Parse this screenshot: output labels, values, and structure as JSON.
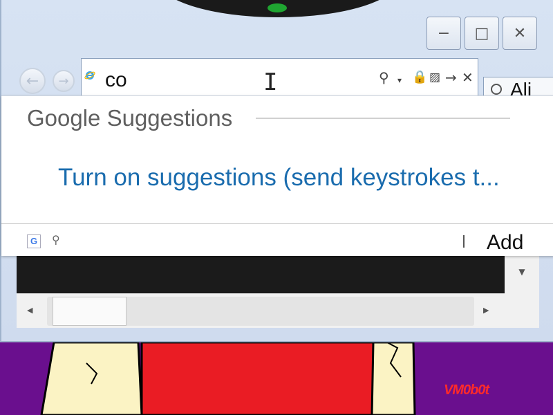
{
  "address_bar": {
    "value": "co",
    "icons": [
      "ie-page-icon",
      "search-icon",
      "dropdown-arrow-icon",
      "lock-icon",
      "compatibility-icon",
      "go-arrow-icon",
      "close-icon"
    ]
  },
  "tab_peek": {
    "label": "Ali"
  },
  "suggestions": {
    "title": "Google Suggestions",
    "link": "Turn on suggestions (send keystrokes t..."
  },
  "footer": {
    "provider_icon": "G",
    "add_label": "Add"
  },
  "window_buttons": {
    "minimize": "−",
    "maximize": "□",
    "close": "✕"
  },
  "desktop": {
    "watermark": "VM0b0t"
  },
  "colors": {
    "link": "#1a6cae",
    "desktop_bg": "#6a0f8e",
    "chrome_bg": "#d7e3f3"
  }
}
